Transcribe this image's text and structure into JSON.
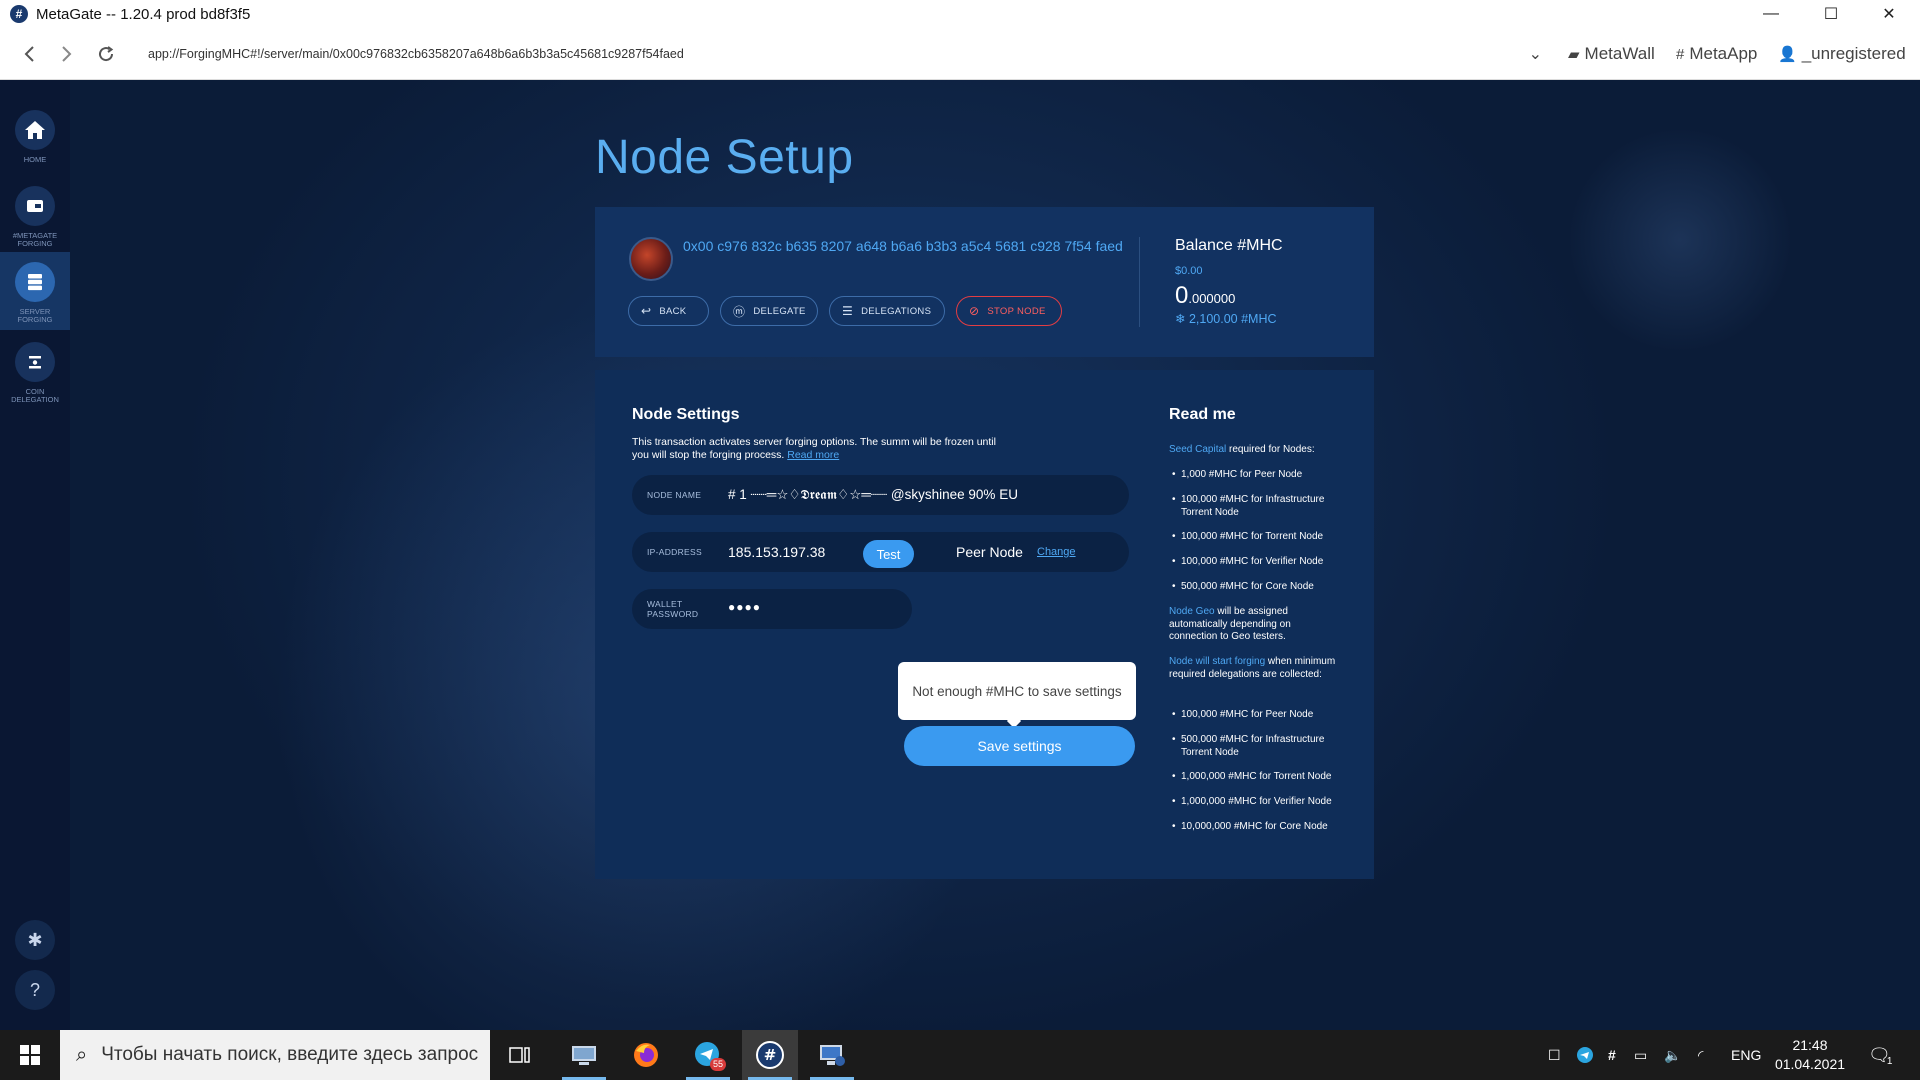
{
  "window": {
    "title": "MetaGate -- 1.20.4 prod bd8f3f5",
    "minimize": "—",
    "maximize": "☐",
    "close": "✕"
  },
  "addressbar": {
    "url": "app://ForgingMHC#!/server/main/0x00c976832cb6358207a648b6a6b3b3a5c45681c9287f54faed",
    "menu": {
      "metawall": "MetaWall",
      "metaapp": "MetaApp",
      "user": "_unregistered"
    }
  },
  "sidebar": {
    "items": [
      {
        "label": "HOME",
        "icon": "home-icon"
      },
      {
        "label": "#METAGATE FORGING",
        "icon": "forging-icon"
      },
      {
        "label": "SERVER FORGING",
        "icon": "server-icon"
      },
      {
        "label": "COIN DELEGATION",
        "icon": "delegation-icon"
      }
    ],
    "settings_icon": "gear-icon",
    "help_label": "?"
  },
  "page": {
    "title": "Node Setup"
  },
  "node": {
    "address": "0x00 c976 832c b635 8207 a648 b6a6 b3b3 a5c4 5681 c928 7f54 faed",
    "buttons": {
      "back": "BACK",
      "delegate": "DELEGATE",
      "delegations": "DELEGATIONS",
      "stop": "STOP NODE"
    },
    "balance": {
      "title": "Balance #MHC",
      "usd": "$0.00",
      "integer": "0",
      "decimals": ".000000",
      "frozen": "2,100.00 #MHC"
    }
  },
  "settings": {
    "title": "Node Settings",
    "description": "This transaction activates server forging options. The summ will be frozen until you will stop the forging process.",
    "read_more": "Read more",
    "node_name_label": "NODE NAME",
    "node_name_value": "# 1 ┈┈═☆♢𝕯𝖗𝖊𝖆𝖒♢☆═┈┈ @skyshinee 90% EU",
    "ip_label": "IP-ADDRESS",
    "ip_value": "185.153.197.38",
    "test_button": "Test",
    "node_type": "Peer Node",
    "change_link": "Change",
    "password_label_1": "WALLET",
    "password_label_2": "PASSWORD",
    "password_value": "●●●●",
    "tooltip": "Not enough #MHC to save settings",
    "save_button": "Save settings"
  },
  "readme": {
    "title": "Read me",
    "seed_highlight": "Seed Capital",
    "seed_rest": " required for Nodes:",
    "seed_items": [
      "1,000 #MHC for Peer Node",
      "100,000 #MHC for Infrastructure Torrent Node",
      "100,000 #MHC for Torrent Node",
      "100,000 #MHC for Verifier Node",
      "500,000 #MHC for Core Node"
    ],
    "geo_highlight": "Node Geo",
    "geo_rest": " will be assigned automatically depending on connection to Geo testers.",
    "forging_highlight": "Node will start forging",
    "forging_rest": " when minimum required delegations are collected:",
    "forging_items": [
      "100,000 #MHC for Peer Node",
      "500,000 #MHC for Infrastructure Torrent Node",
      "1,000,000 #MHC for Torrent Node",
      "1,000,000 #MHC for Verifier Node",
      "10,000,000 #MHC for Core Node"
    ]
  },
  "taskbar": {
    "search_placeholder": "Чтобы начать поиск, введите здесь запрос",
    "telegram_badge": "55",
    "language": "ENG",
    "time": "21:48",
    "date": "01.04.2021",
    "notification_count": "1"
  },
  "colors": {
    "accent": "#3a9af0",
    "link": "#4fa8f3",
    "stop": "#e23d43",
    "card": "#123261"
  }
}
